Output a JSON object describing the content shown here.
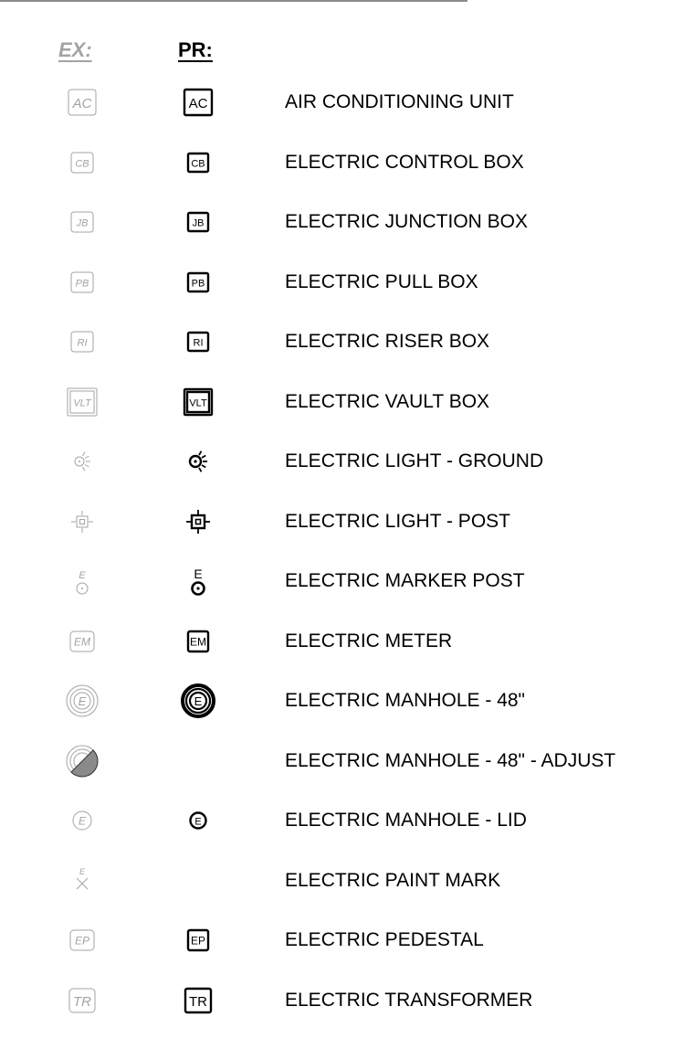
{
  "header": {
    "ex": "EX:",
    "pr": "PR:"
  },
  "colors": {
    "existing": "#a3a3a3",
    "proposed": "#000000"
  },
  "rows": [
    {
      "description": "AIR CONDITIONING UNIT",
      "icon": "box-icon",
      "code": "AC"
    },
    {
      "description": "ELECTRIC CONTROL BOX",
      "icon": "box-icon",
      "code": "CB"
    },
    {
      "description": "ELECTRIC JUNCTION BOX",
      "icon": "box-icon",
      "code": "JB"
    },
    {
      "description": "ELECTRIC PULL BOX",
      "icon": "box-icon",
      "code": "PB"
    },
    {
      "description": "ELECTRIC RISER BOX",
      "icon": "box-icon",
      "code": "RI"
    },
    {
      "description": "ELECTRIC VAULT BOX",
      "icon": "vault-box-icon",
      "code": "VLT"
    },
    {
      "description": "ELECTRIC LIGHT - GROUND",
      "icon": "ground-light-icon"
    },
    {
      "description": "ELECTRIC LIGHT - POST",
      "icon": "post-light-icon"
    },
    {
      "description": "ELECTRIC MARKER POST",
      "icon": "marker-post-icon",
      "code": "E"
    },
    {
      "description": "ELECTRIC METER",
      "icon": "meter-icon",
      "code": "EM"
    },
    {
      "description": "ELECTRIC MANHOLE - 48\"",
      "icon": "manhole-icon",
      "code": "E"
    },
    {
      "description": "ELECTRIC MANHOLE - 48\" - ADJUST",
      "icon": "manhole-adjust-icon"
    },
    {
      "description": "ELECTRIC MANHOLE - LID",
      "icon": "manhole-lid-icon",
      "code": "E"
    },
    {
      "description": "ELECTRIC PAINT MARK",
      "icon": "paint-mark-icon",
      "code": "E"
    },
    {
      "description": "ELECTRIC PEDESTAL",
      "icon": "pedestal-icon",
      "code": "EP"
    },
    {
      "description": "ELECTRIC TRANSFORMER",
      "icon": "transformer-icon",
      "code": "TR"
    }
  ]
}
